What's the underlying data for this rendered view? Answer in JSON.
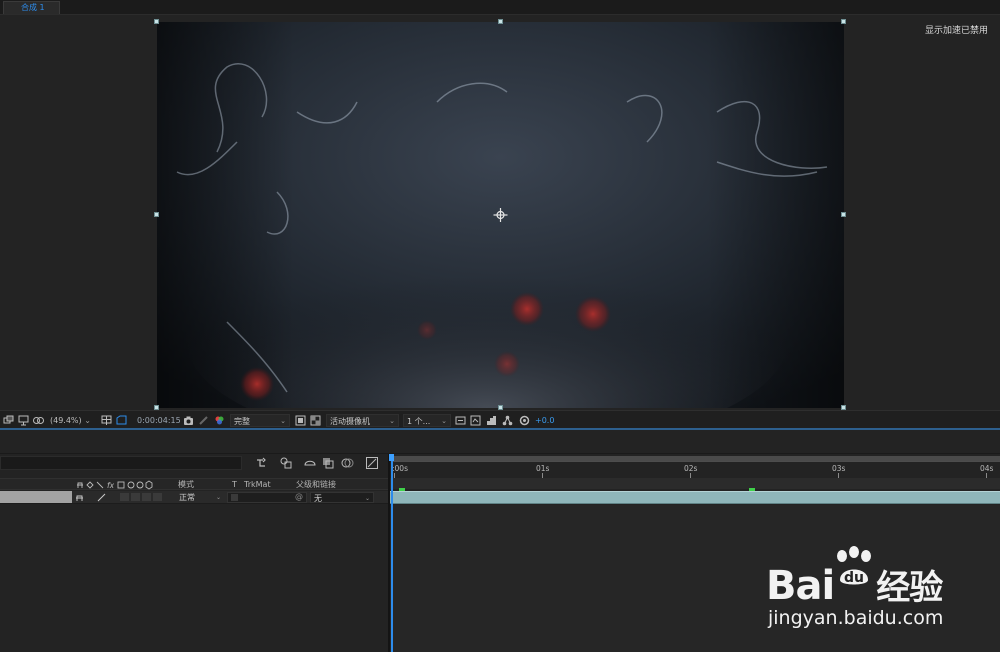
{
  "viewer": {
    "comp_tab_label": "合成 1",
    "gpu_notice": "显示加速已禁用"
  },
  "toolbar": {
    "zoom": "(49.4%)",
    "timecode": "0:00:04:15",
    "resolution": "完整",
    "camera": "活动摄像机",
    "views": "1 个...",
    "exposure": "+0.0",
    "accent_color": "#2d8ceb"
  },
  "timeline": {
    "columns": {
      "mode": "模式",
      "t": "T",
      "trkmat": "TrkMat",
      "parent": "父级和链接"
    },
    "layer": {
      "mode_value": "正常",
      "parent_value": "无"
    },
    "ruler_ticks": [
      ":00s",
      "01s",
      "02s",
      "03s",
      "04s"
    ],
    "keyframe_color": "#3fd14a",
    "layer_bar_color": "#8fb6ba"
  },
  "watermark": {
    "brand": "Bai",
    "brand_cn": "经验",
    "domain": "jingyan.baidu.com"
  }
}
